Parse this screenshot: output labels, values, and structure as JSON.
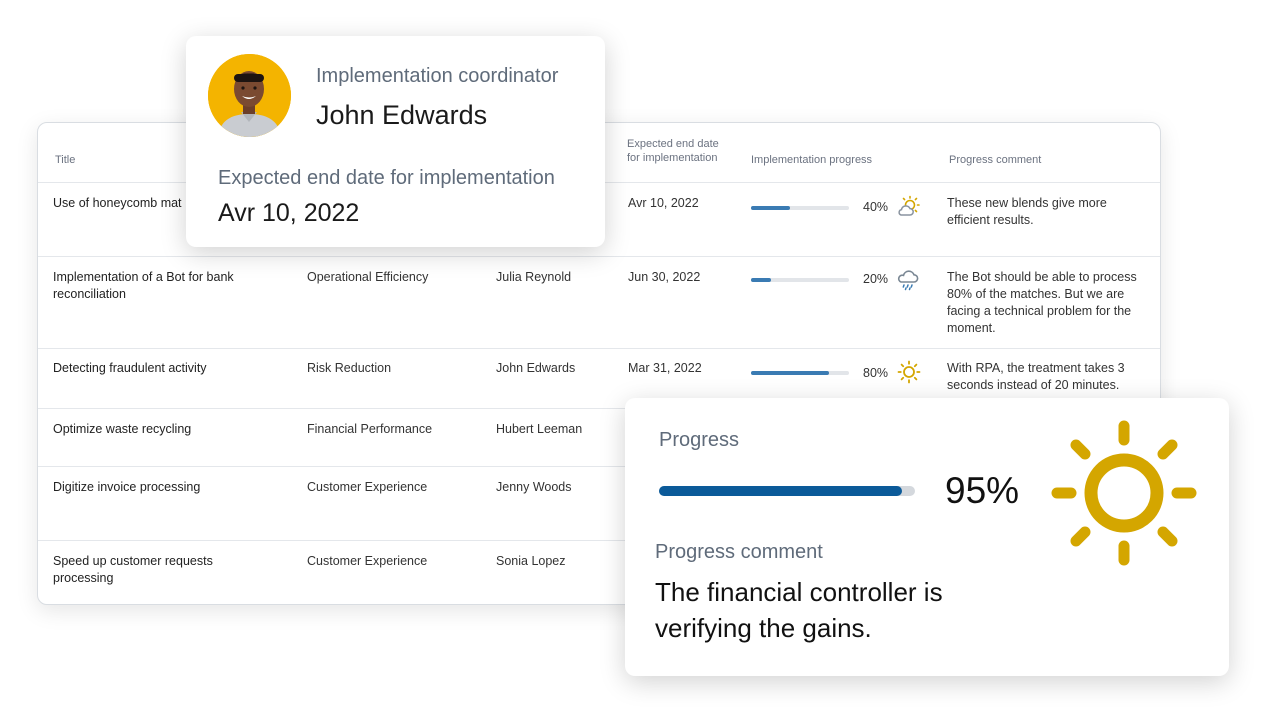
{
  "table": {
    "headers": {
      "title": "Title",
      "end_date_line1": "Expected end date",
      "end_date_line2": "for implementation",
      "progress": "Implementation progress",
      "comment": "Progress comment"
    },
    "rows": [
      {
        "title": "Use of honeycomb mat",
        "category": "",
        "coordinator": "",
        "end_date": "Avr 10, 2022",
        "progress": 40,
        "progress_text": "40%",
        "weather_icon": "partly-cloudy-icon",
        "comment": "These new blends give more efficient results."
      },
      {
        "title": "Implementation of a Bot for bank reconciliation",
        "category": "Operational Efficiency",
        "coordinator": "Julia Reynold",
        "end_date": "Jun 30, 2022",
        "progress": 20,
        "progress_text": "20%",
        "weather_icon": "rain-cloud-icon",
        "comment": "The Bot should be able to process 80% of the matches. But we are facing a technical problem for the moment."
      },
      {
        "title": "Detecting fraudulent activity",
        "category": "Risk Reduction",
        "coordinator": "John Edwards",
        "end_date": "Mar 31, 2022",
        "progress": 80,
        "progress_text": "80%",
        "weather_icon": "sun-icon",
        "comment": "With RPA, the treatment takes 3 seconds instead of 20 minutes."
      },
      {
        "title": "Optimize waste recycling",
        "category": "Financial Performance",
        "coordinator": "Hubert Leeman"
      },
      {
        "title": "Digitize invoice processing",
        "category": "Customer Experience",
        "coordinator": "Jenny Woods"
      },
      {
        "title": "Speed up customer requests processing",
        "category": "Customer Experience",
        "coordinator": "Sonia Lopez"
      }
    ]
  },
  "coordinator_card": {
    "role": "Implementation coordinator",
    "name": "John Edwards",
    "date_label": "Expected end date for implementation",
    "date": "Avr 10, 2022",
    "avatar_icon": "person-avatar"
  },
  "progress_card": {
    "label": "Progress",
    "progress": 95,
    "progress_text": "95%",
    "comment_label": "Progress comment",
    "comment": "The financial controller is verifying the gains.",
    "weather_icon": "sun-icon"
  },
  "colors": {
    "bar_fill": "#3a7bb3",
    "big_bar_fill": "#0b5a99",
    "sun": "#d4a600",
    "avatar_bg": "#f4b400"
  }
}
